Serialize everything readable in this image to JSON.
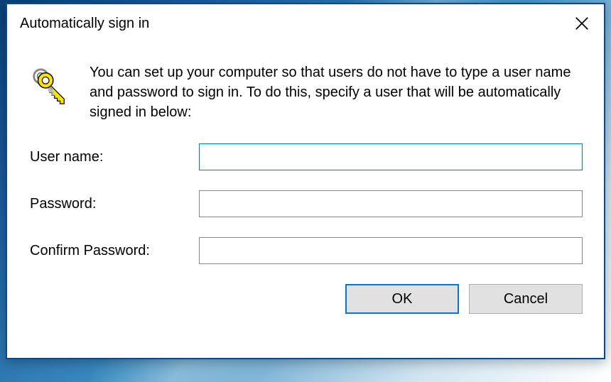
{
  "dialog": {
    "title": "Automatically sign in",
    "description": "You can set up your computer so that users do not have to type a user name and password to sign in. To do this, specify a user that will be automatically signed in below:",
    "labels": {
      "username": "User name:",
      "password": "Password:",
      "confirm": "Confirm Password:"
    },
    "values": {
      "username": "",
      "password": "",
      "confirm": ""
    },
    "buttons": {
      "ok": "OK",
      "cancel": "Cancel"
    }
  }
}
